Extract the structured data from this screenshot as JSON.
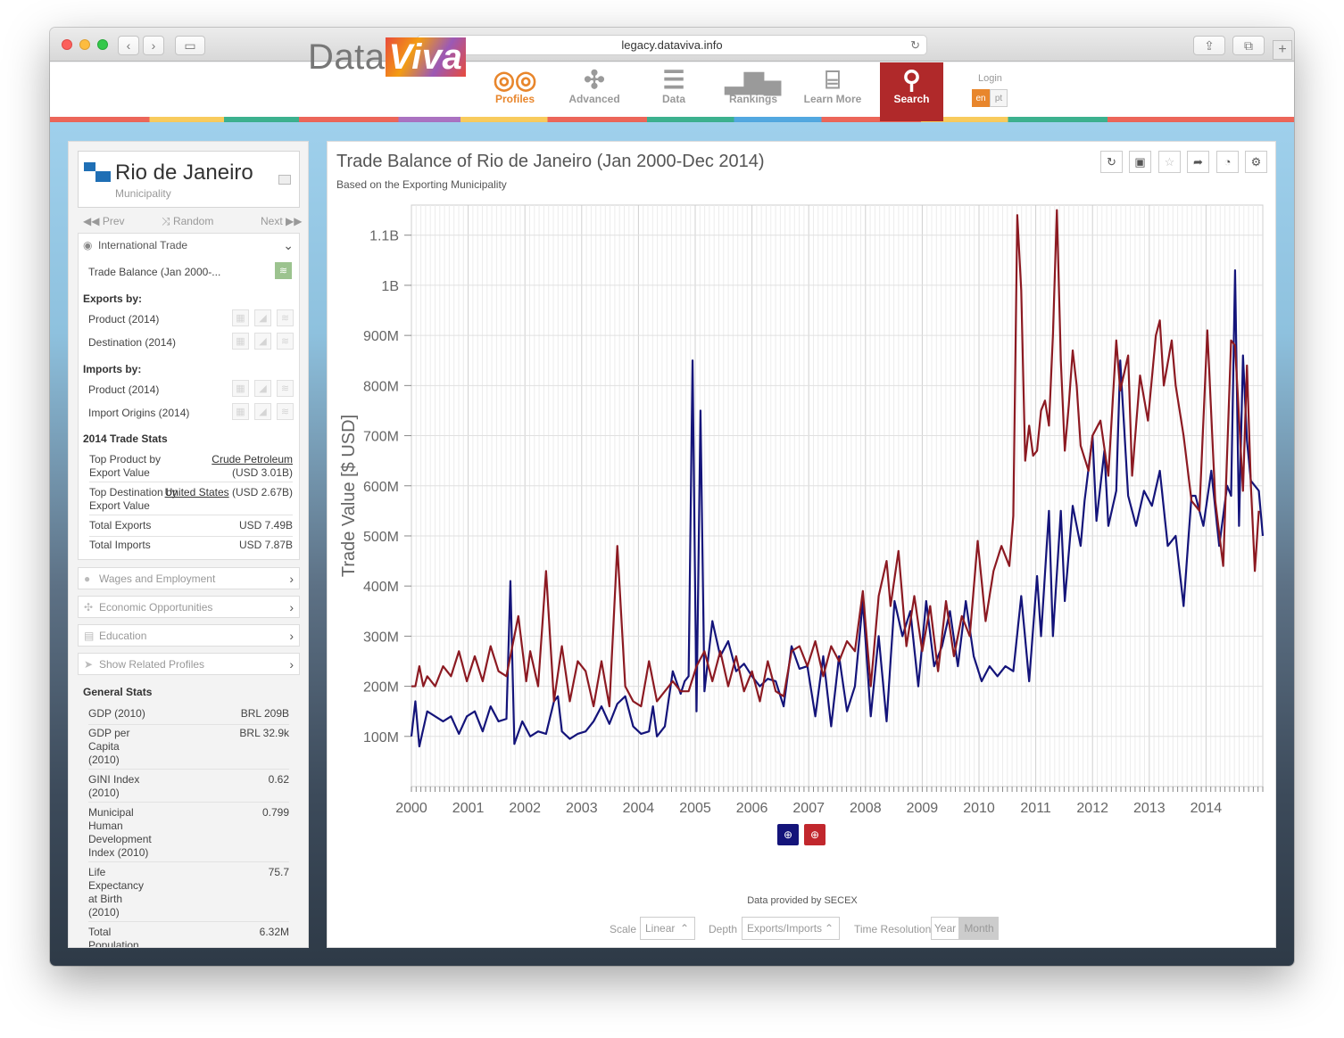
{
  "browser": {
    "url": "legacy.dataviva.info"
  },
  "nav": {
    "logo_text": "DataViva",
    "items": [
      {
        "label": "Profiles",
        "icon": "binoculars-icon"
      },
      {
        "label": "Advanced",
        "icon": "network-icon"
      },
      {
        "label": "Data",
        "icon": "table-icon"
      },
      {
        "label": "Rankings",
        "icon": "bar-chart-icon"
      },
      {
        "label": "Learn More",
        "icon": "book-icon"
      },
      {
        "label": "Search",
        "icon": "search-icon"
      }
    ],
    "login": "Login",
    "lang_en": "en",
    "lang_pt": "pt"
  },
  "profile": {
    "name": "Rio de Janeiro",
    "type": "Municipality",
    "prev": "Prev",
    "random": "Random",
    "next": "Next",
    "trade_section": "International Trade",
    "trade_balance_item": "Trade Balance (Jan 2000-...",
    "exports_by": "Exports by:",
    "exports_product": "Product (2014)",
    "exports_destination": "Destination (2014)",
    "imports_by": "Imports by:",
    "imports_product": "Product (2014)",
    "imports_origins": "Import Origins (2014)",
    "trade_stats_title": "2014 Trade Stats",
    "top_product_label": "Top Product by Export Value",
    "top_product_value": "Crude Petroleum",
    "top_product_amount": "(USD 3.01B)",
    "top_dest_label": "Top Destination by Export Value",
    "top_dest_value": "United States",
    "top_dest_amount": "(USD 2.67B)",
    "total_exports_label": "Total Exports",
    "total_exports_value": "USD 7.49B",
    "total_imports_label": "Total Imports",
    "total_imports_value": "USD 7.87B",
    "wages": "Wages and Employment",
    "econ": "Economic Opportunities",
    "education": "Education",
    "related": "Show Related Profiles",
    "general_stats": "General Stats",
    "stats": [
      {
        "label": "GDP (2010)",
        "value": "BRL 209B"
      },
      {
        "label": "GDP per Capita (2010)",
        "value": "BRL 32.9k"
      },
      {
        "label": "GINI Index (2010)",
        "value": "0.62"
      },
      {
        "label": "Municipal Human Development Index (2010)",
        "value": "0.799"
      },
      {
        "label": "Life Expectancy at Birth (2010)",
        "value": "75.7"
      },
      {
        "label": "Total Population",
        "value": "6.32M"
      }
    ]
  },
  "chart_panel": {
    "title": "Trade Balance of Rio de Janeiro (Jan 2000-Dec 2014)",
    "subtitle": "Based on the Exporting Municipality",
    "source": "Data provided by SECEX",
    "scale_label": "Scale",
    "scale_value": "Linear",
    "depth_label": "Depth",
    "depth_value": "Exports/Imports",
    "time_label": "Time Resolution",
    "time_year": "Year",
    "time_month": "Month",
    "colors": {
      "exports": "#14147a",
      "imports": "#8c1a22"
    }
  },
  "chart_data": {
    "type": "line",
    "ylabel": "Trade Value [$ USD]",
    "xlabel": "",
    "ylim": [
      0,
      1.16
    ],
    "y_unit": "billions USD",
    "yticks": [
      "100M",
      "200M",
      "300M",
      "400M",
      "500M",
      "600M",
      "700M",
      "800M",
      "900M",
      "1B",
      "1.1B"
    ],
    "xticks": [
      "2000",
      "2001",
      "2002",
      "2003",
      "2004",
      "2005",
      "2006",
      "2007",
      "2008",
      "2009",
      "2010",
      "2011",
      "2012",
      "2013",
      "2014"
    ],
    "x_start": "2000-01",
    "x_end": "2014-12",
    "series": [
      {
        "legend_icon": "export-globe-icon",
        "color": "#14147a",
        "keypoints": [
          [
            0,
            0.1
          ],
          [
            1,
            0.17
          ],
          [
            2,
            0.08
          ],
          [
            4,
            0.15
          ],
          [
            6,
            0.14
          ],
          [
            8,
            0.13
          ],
          [
            10,
            0.14
          ],
          [
            12,
            0.105
          ],
          [
            14,
            0.14
          ],
          [
            16,
            0.15
          ],
          [
            18,
            0.11
          ],
          [
            20,
            0.16
          ],
          [
            22,
            0.13
          ],
          [
            24,
            0.135
          ],
          [
            25,
            0.41
          ],
          [
            26,
            0.085
          ],
          [
            28,
            0.13
          ],
          [
            30,
            0.1
          ],
          [
            32,
            0.11
          ],
          [
            34,
            0.105
          ],
          [
            36,
            0.17
          ],
          [
            37,
            0.18
          ],
          [
            38,
            0.11
          ],
          [
            40,
            0.095
          ],
          [
            42,
            0.105
          ],
          [
            44,
            0.11
          ],
          [
            46,
            0.13
          ],
          [
            48,
            0.16
          ],
          [
            50,
            0.125
          ],
          [
            52,
            0.165
          ],
          [
            54,
            0.18
          ],
          [
            56,
            0.12
          ],
          [
            58,
            0.105
          ],
          [
            60,
            0.11
          ],
          [
            61,
            0.16
          ],
          [
            62,
            0.1
          ],
          [
            64,
            0.12
          ],
          [
            66,
            0.23
          ],
          [
            68,
            0.185
          ],
          [
            69,
            0.21
          ],
          [
            70,
            0.22
          ],
          [
            71,
            0.85
          ],
          [
            72,
            0.15
          ],
          [
            73,
            0.75
          ],
          [
            74,
            0.19
          ],
          [
            76,
            0.33
          ],
          [
            78,
            0.26
          ],
          [
            80,
            0.29
          ],
          [
            82,
            0.23
          ],
          [
            84,
            0.245
          ],
          [
            86,
            0.22
          ],
          [
            88,
            0.2
          ],
          [
            90,
            0.215
          ],
          [
            92,
            0.21
          ],
          [
            94,
            0.16
          ],
          [
            96,
            0.28
          ],
          [
            98,
            0.235
          ],
          [
            100,
            0.24
          ],
          [
            102,
            0.14
          ],
          [
            104,
            0.26
          ],
          [
            106,
            0.12
          ],
          [
            108,
            0.26
          ],
          [
            110,
            0.15
          ],
          [
            112,
            0.2
          ],
          [
            114,
            0.37
          ],
          [
            116,
            0.14
          ],
          [
            118,
            0.3
          ],
          [
            120,
            0.13
          ],
          [
            122,
            0.37
          ],
          [
            124,
            0.3
          ],
          [
            126,
            0.35
          ],
          [
            128,
            0.2
          ],
          [
            130,
            0.37
          ],
          [
            132,
            0.24
          ],
          [
            134,
            0.28
          ],
          [
            136,
            0.35
          ],
          [
            138,
            0.24
          ],
          [
            140,
            0.37
          ],
          [
            142,
            0.26
          ],
          [
            144,
            0.21
          ],
          [
            146,
            0.24
          ],
          [
            148,
            0.22
          ],
          [
            150,
            0.24
          ],
          [
            152,
            0.23
          ],
          [
            154,
            0.38
          ],
          [
            156,
            0.21
          ],
          [
            158,
            0.42
          ],
          [
            159,
            0.3
          ],
          [
            161,
            0.55
          ],
          [
            162,
            0.3
          ],
          [
            164,
            0.55
          ],
          [
            165,
            0.37
          ],
          [
            167,
            0.56
          ],
          [
            169,
            0.48
          ],
          [
            170,
            0.57
          ],
          [
            172,
            0.7
          ],
          [
            173,
            0.53
          ],
          [
            175,
            0.67
          ],
          [
            176,
            0.52
          ],
          [
            178,
            0.59
          ],
          [
            179,
            0.85
          ],
          [
            181,
            0.58
          ],
          [
            183,
            0.52
          ],
          [
            185,
            0.59
          ],
          [
            187,
            0.56
          ],
          [
            189,
            0.63
          ],
          [
            191,
            0.48
          ],
          [
            193,
            0.5
          ],
          [
            195,
            0.36
          ],
          [
            197,
            0.58
          ],
          [
            198,
            0.58
          ],
          [
            200,
            0.52
          ],
          [
            202,
            0.63
          ],
          [
            204,
            0.48
          ],
          [
            206,
            0.6
          ],
          [
            207,
            0.58
          ],
          [
            208,
            1.03
          ],
          [
            209,
            0.52
          ],
          [
            210,
            0.86
          ],
          [
            211,
            0.69
          ],
          [
            212,
            0.61
          ],
          [
            214,
            0.59
          ],
          [
            215,
            0.5
          ]
        ]
      },
      {
        "legend_icon": "import-globe-icon",
        "color": "#8c1a22",
        "keypoints": [
          [
            0,
            0.2
          ],
          [
            1,
            0.2
          ],
          [
            2,
            0.24
          ],
          [
            3,
            0.2
          ],
          [
            4,
            0.22
          ],
          [
            6,
            0.2
          ],
          [
            8,
            0.24
          ],
          [
            10,
            0.22
          ],
          [
            12,
            0.27
          ],
          [
            14,
            0.21
          ],
          [
            16,
            0.26
          ],
          [
            18,
            0.21
          ],
          [
            20,
            0.28
          ],
          [
            22,
            0.23
          ],
          [
            24,
            0.22
          ],
          [
            26,
            0.3
          ],
          [
            27,
            0.34
          ],
          [
            29,
            0.21
          ],
          [
            30,
            0.27
          ],
          [
            32,
            0.2
          ],
          [
            34,
            0.43
          ],
          [
            36,
            0.17
          ],
          [
            38,
            0.28
          ],
          [
            40,
            0.17
          ],
          [
            42,
            0.25
          ],
          [
            44,
            0.23
          ],
          [
            46,
            0.16
          ],
          [
            48,
            0.25
          ],
          [
            50,
            0.16
          ],
          [
            52,
            0.48
          ],
          [
            54,
            0.2
          ],
          [
            56,
            0.17
          ],
          [
            58,
            0.16
          ],
          [
            60,
            0.25
          ],
          [
            62,
            0.17
          ],
          [
            64,
            0.19
          ],
          [
            66,
            0.21
          ],
          [
            68,
            0.19
          ],
          [
            70,
            0.19
          ],
          [
            72,
            0.24
          ],
          [
            74,
            0.27
          ],
          [
            76,
            0.21
          ],
          [
            78,
            0.27
          ],
          [
            80,
            0.2
          ],
          [
            82,
            0.26
          ],
          [
            84,
            0.19
          ],
          [
            86,
            0.23
          ],
          [
            88,
            0.17
          ],
          [
            90,
            0.25
          ],
          [
            92,
            0.19
          ],
          [
            94,
            0.18
          ],
          [
            96,
            0.27
          ],
          [
            98,
            0.28
          ],
          [
            100,
            0.24
          ],
          [
            102,
            0.29
          ],
          [
            104,
            0.22
          ],
          [
            106,
            0.28
          ],
          [
            108,
            0.25
          ],
          [
            110,
            0.29
          ],
          [
            112,
            0.27
          ],
          [
            114,
            0.39
          ],
          [
            116,
            0.2
          ],
          [
            118,
            0.38
          ],
          [
            120,
            0.45
          ],
          [
            121,
            0.36
          ],
          [
            123,
            0.47
          ],
          [
            125,
            0.28
          ],
          [
            127,
            0.38
          ],
          [
            129,
            0.27
          ],
          [
            131,
            0.36
          ],
          [
            133,
            0.23
          ],
          [
            135,
            0.37
          ],
          [
            137,
            0.26
          ],
          [
            139,
            0.34
          ],
          [
            141,
            0.3
          ],
          [
            143,
            0.49
          ],
          [
            145,
            0.33
          ],
          [
            147,
            0.43
          ],
          [
            149,
            0.48
          ],
          [
            151,
            0.44
          ],
          [
            152,
            0.54
          ],
          [
            153,
            1.14
          ],
          [
            154,
            0.99
          ],
          [
            155,
            0.65
          ],
          [
            156,
            0.72
          ],
          [
            157,
            0.66
          ],
          [
            158,
            0.67
          ],
          [
            159,
            0.75
          ],
          [
            160,
            0.77
          ],
          [
            161,
            0.72
          ],
          [
            162,
            0.9
          ],
          [
            163,
            1.15
          ],
          [
            164,
            0.85
          ],
          [
            165,
            0.67
          ],
          [
            166,
            0.76
          ],
          [
            167,
            0.87
          ],
          [
            168,
            0.8
          ],
          [
            169,
            0.68
          ],
          [
            171,
            0.63
          ],
          [
            172,
            0.7
          ],
          [
            174,
            0.73
          ],
          [
            176,
            0.62
          ],
          [
            178,
            0.89
          ],
          [
            179,
            0.79
          ],
          [
            181,
            0.86
          ],
          [
            182,
            0.62
          ],
          [
            184,
            0.82
          ],
          [
            186,
            0.73
          ],
          [
            188,
            0.9
          ],
          [
            189,
            0.93
          ],
          [
            190,
            0.8
          ],
          [
            192,
            0.89
          ],
          [
            193,
            0.8
          ],
          [
            195,
            0.7
          ],
          [
            197,
            0.57
          ],
          [
            199,
            0.55
          ],
          [
            201,
            0.91
          ],
          [
            203,
            0.57
          ],
          [
            205,
            0.44
          ],
          [
            207,
            0.89
          ],
          [
            208,
            0.88
          ],
          [
            210,
            0.59
          ],
          [
            211,
            0.84
          ],
          [
            212,
            0.6
          ],
          [
            213,
            0.43
          ],
          [
            214,
            0.55
          ]
        ]
      }
    ]
  }
}
